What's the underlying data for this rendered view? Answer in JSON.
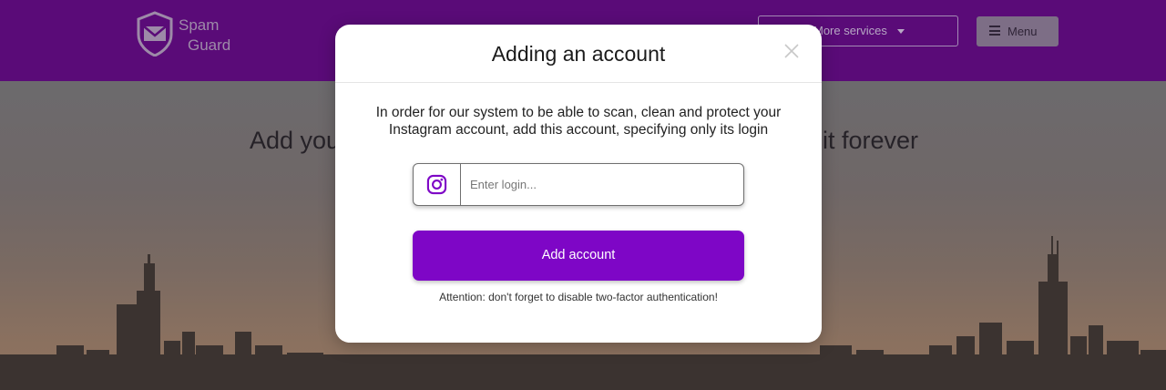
{
  "header": {
    "logo_line1": "Spam",
    "logo_line2": "Guard",
    "services_label": "More services",
    "menu_label": "Menu",
    "background_color": "#5a0b78"
  },
  "hero": {
    "text_left": "Add you",
    "text_right": "it forever"
  },
  "modal": {
    "title": "Adding an account",
    "description": "In order for our system to be able to scan, clean and protect your Instagram account, add this account, specifying only its login",
    "login_placeholder": "Enter login...",
    "login_value": "",
    "add_button_label": "Add account",
    "attention_text": "Attention: don't forget to disable two-factor authentication!",
    "accent_color": "#7e06c6",
    "icons": {
      "close": "close-icon",
      "instagram": "instagram-icon"
    }
  }
}
